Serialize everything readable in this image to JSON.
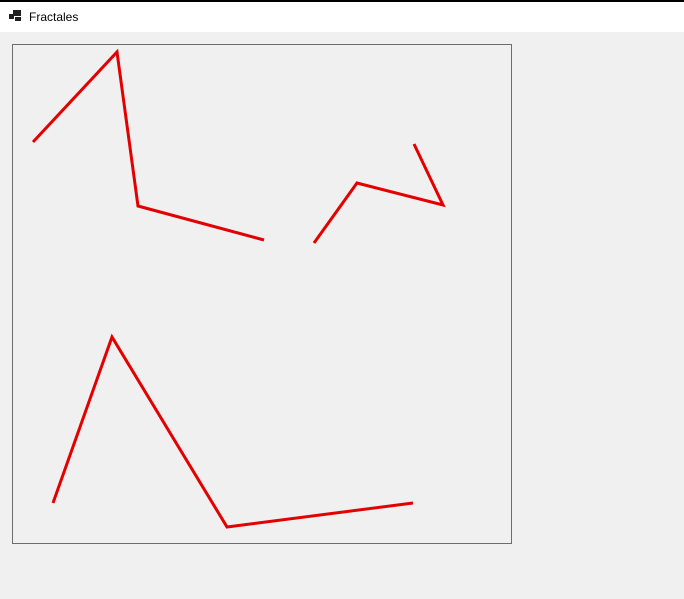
{
  "window": {
    "title": "Fractales",
    "icon": "app-window-icon"
  },
  "canvas": {
    "stroke_color": "#e30000",
    "segments": [
      [
        [
          20,
          97
        ],
        [
          104,
          7
        ],
        [
          125,
          161
        ],
        [
          251,
          195
        ]
      ],
      [
        [
          301,
          198
        ],
        [
          344,
          138
        ],
        [
          430,
          160
        ],
        [
          401,
          99
        ]
      ],
      [
        [
          40,
          458
        ],
        [
          99,
          292
        ],
        [
          214,
          482
        ],
        [
          400,
          458
        ]
      ]
    ]
  }
}
